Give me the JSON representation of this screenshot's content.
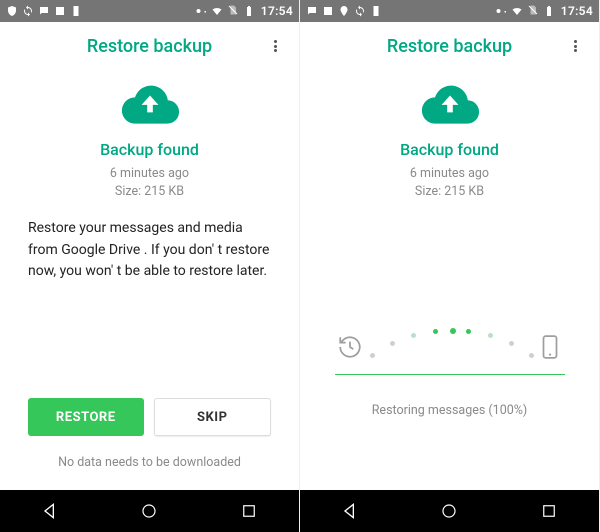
{
  "accent": "#00a884",
  "primary_button": "#35c759",
  "status": {
    "clock": "17:54"
  },
  "left": {
    "appbar_title": "Restore backup",
    "found_title": "Backup found",
    "meta_time": "6 minutes ago",
    "meta_size": "Size: 215 KB",
    "explain": "Restore your messages and media from Google Drive . If you don' t restore now, you won' t be able to restore later.",
    "restore_label": "RESTORE",
    "skip_label": "SKIP",
    "footnote": "No data needs to be downloaded"
  },
  "right": {
    "appbar_title": "Restore backup",
    "found_title": "Backup found",
    "meta_time": "6 minutes ago",
    "meta_size": "Size: 215 KB",
    "progress_text": "Restoring messages (100%)"
  }
}
